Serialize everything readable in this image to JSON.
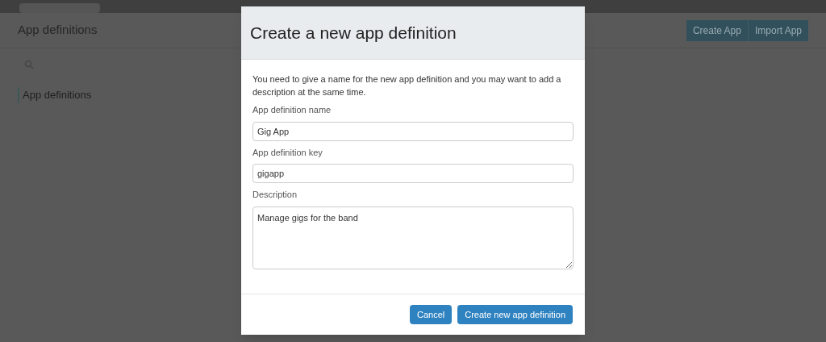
{
  "page": {
    "title": "App definitions",
    "actions": [
      {
        "label": "Create App"
      },
      {
        "label": "Import App"
      }
    ],
    "sidebar": {
      "items": [
        {
          "label": "App definitions",
          "selected": true
        }
      ]
    }
  },
  "dialog": {
    "title": "Create a new app definition",
    "intro": "You need to give a name for the new app definition and you may want to add a description at the same time.",
    "fields": [
      {
        "kind": "text",
        "label": "App definition name",
        "value": "Gig App"
      },
      {
        "kind": "text",
        "label": "App definition key",
        "value": "gigapp"
      },
      {
        "kind": "textarea",
        "label": "Description",
        "value": "Manage gigs for the band"
      }
    ],
    "buttons": [
      {
        "label": "Cancel"
      },
      {
        "label": "Create new app definition"
      }
    ]
  }
}
